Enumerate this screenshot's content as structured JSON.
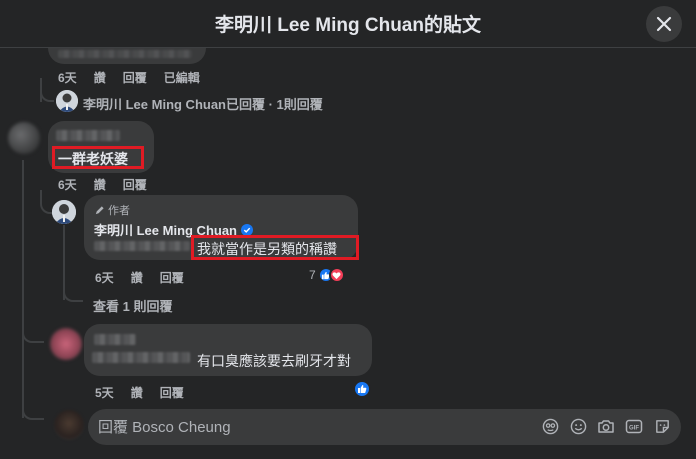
{
  "header": {
    "title": "李明川 Lee Ming Chuan的貼文"
  },
  "comment_top": {
    "meta": {
      "time": "6天",
      "like": "讚",
      "reply": "回覆",
      "edited": "已編輯"
    },
    "author_replied": "李明川 Lee Ming Chuan已回覆 · 1則回覆"
  },
  "comment_main": {
    "text": "一群老妖婆",
    "meta": {
      "time": "6天",
      "like": "讚",
      "reply": "回覆"
    }
  },
  "author_reply": {
    "badge": "作者",
    "name": "李明川 Lee Ming Chuan",
    "text": "我就當作是另類的稱讚",
    "meta": {
      "time": "6天",
      "like": "讚",
      "reply": "回覆"
    },
    "reaction_count": "7",
    "view_replies": "查看 1 則回覆"
  },
  "comment_second": {
    "text": "有口臭應該要去刷牙才對",
    "meta": {
      "time": "5天",
      "like": "讚",
      "reply": "回覆"
    }
  },
  "reply_box": {
    "placeholder": "回覆 Bosco Cheung"
  },
  "colors": {
    "accent_blue": "#1877f2",
    "highlight_red": "#e01b24",
    "love_red": "#f33e58"
  }
}
